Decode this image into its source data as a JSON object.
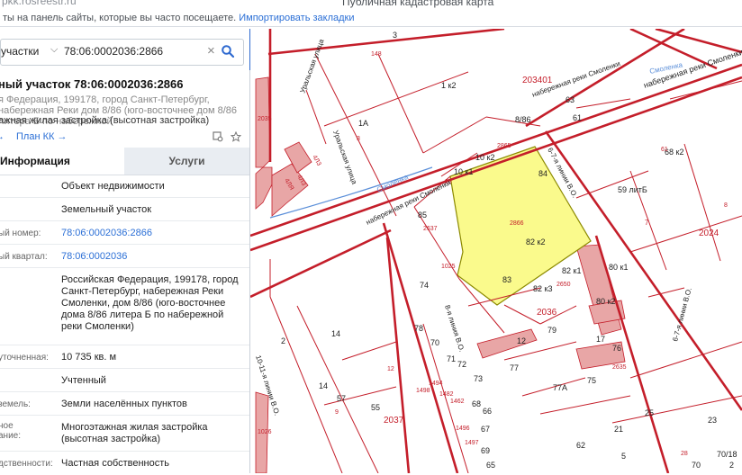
{
  "browser": {
    "url": "pkk.rosreestr.ru",
    "bookmarks_text": "ты на панель сайты, которые вы часто посещаете.",
    "import_link": "Импортировать закладки",
    "page_title": "Публичная кадастровая карта"
  },
  "search": {
    "scope": "участки",
    "query": "78:06:0002036:2866"
  },
  "object": {
    "title": "ный участок 78:06:0002036:2866",
    "address_preview": "я Федерация, 199178, город Санкт-Петербург, набережная Реки дом 8/86 (юго-восточнее дом 8/86 литера Б по набережной",
    "use": "ажная жилая застройка (высотная застройка)",
    "link_arrow": "→",
    "plan_link": "План КК →"
  },
  "tabs": {
    "info": "Информация",
    "services": "Услуги"
  },
  "rows": [
    {
      "label": "",
      "value": "Объект недвижимости"
    },
    {
      "label": "",
      "value": "Земельный участок"
    },
    {
      "label": "ый номер:",
      "value": "78:06:0002036:2866"
    },
    {
      "label": "ый квартал:",
      "value": "78:06:0002036"
    },
    {
      "label": "",
      "value": "Российская Федерация, 199178, город Санкт-Петербург, набережная Реки Смоленки, дом 8/86 (юго-восточнее дома 8/86 литера Б по набережной реки Смоленки)"
    },
    {
      "label": "уточненная:",
      "value": "10 735 кв. м"
    },
    {
      "label": "",
      "value": "Учтенный"
    },
    {
      "label": "земель:",
      "value": "Земли населённых пунктов"
    },
    {
      "label": "ное\nание:",
      "value": "Многоэтажная жилая застройка (высотная застройка)"
    },
    {
      "label": "дственности:",
      "value": "Частная собственность"
    }
  ],
  "map": {
    "parcel_label": "2866",
    "labels": [
      "3",
      "148",
      "1 к2",
      "1А",
      "3",
      "4ЛЯ",
      "4ЛЗ",
      "4Л3",
      "2035",
      "203401",
      "набережная реки Смоленки",
      "набережная реки Смоленки",
      "63",
      "61",
      "8/86",
      "2865",
      "10 к1",
      "10 к2",
      "84",
      "23",
      "85",
      "2637",
      "82 к2",
      "1025",
      "83",
      "82 к1",
      "82 к3",
      "2650",
      "80 к1",
      "80 к2",
      "59 литБ",
      "7",
      "68 к2",
      "61",
      "2024",
      "8",
      "Смоленка",
      "Смоленка",
      "Уральская улица",
      "Уральская улица",
      "набережная реки Смоленки",
      "6-7-я линии В.О.",
      "6-7-я линии В.О.",
      "8-я линия В.О.",
      "10-11-я линии В.О.",
      "2036",
      "79",
      "12",
      "17",
      "77",
      "77А",
      "76",
      "2635",
      "75",
      "74",
      "78",
      "72",
      "73",
      "70",
      "71",
      "1498",
      "1494",
      "1482",
      "1462",
      "1496",
      "1497",
      "67",
      "68",
      "69",
      "66",
      "65",
      "2",
      "14",
      "14",
      "57",
      "55",
      "9",
      "12",
      "2037",
      "1026",
      "21",
      "25",
      "23",
      "28",
      "70/18",
      "70",
      "2",
      "62",
      "5"
    ]
  },
  "colors": {
    "accent": "#2f6ad0",
    "parcel_fill": "#fafa8c",
    "boundary": "#c41e2a",
    "building_fill": "#e5a0a0"
  }
}
